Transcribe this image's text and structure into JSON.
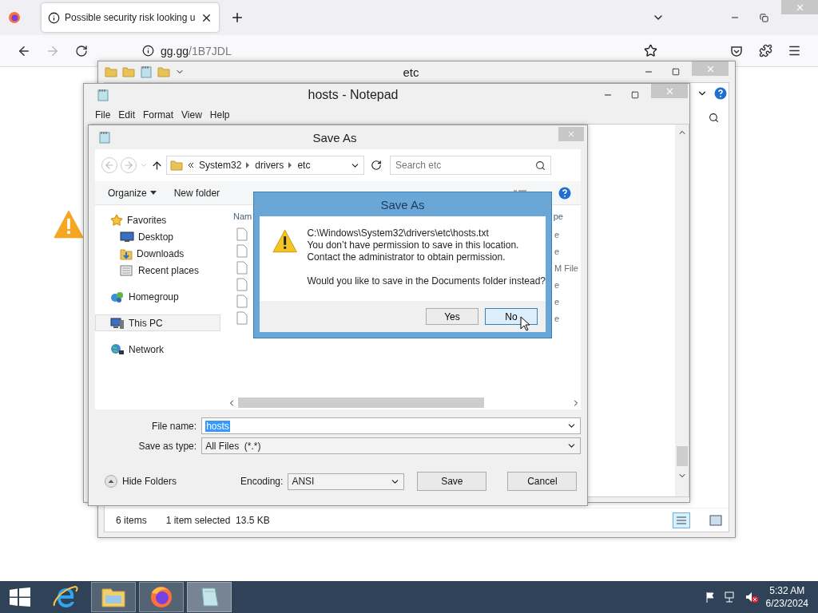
{
  "browser": {
    "tabs": [
      {
        "title": "Possible security risk looking u",
        "selected": true
      }
    ],
    "url": {
      "host": "gg.gg",
      "path": "/1B7JDL"
    }
  },
  "explorer": {
    "title": "etc",
    "status_items": "6 items",
    "status_selection": "1 item selected  13.5 KB"
  },
  "notepad": {
    "title": "hosts - Notepad",
    "menu": [
      "File",
      "Edit",
      "Format",
      "View",
      "Help"
    ]
  },
  "save_dialog": {
    "title": "Save As",
    "breadcrumb": [
      "System32",
      "drivers",
      "etc"
    ],
    "search": {
      "placeholder": "Search etc"
    },
    "toolbar": [
      "Organize",
      "New folder"
    ],
    "nav": [
      {
        "label": "Favorites",
        "kind": "star",
        "selected": false,
        "children": [
          {
            "label": "Desktop",
            "kind": "desktop",
            "selected": false
          },
          {
            "label": "Downloads",
            "kind": "downloads",
            "selected": false
          },
          {
            "label": "Recent places",
            "kind": "recent",
            "selected": false
          }
        ]
      },
      {
        "label": "Homegroup",
        "kind": "homegroup",
        "selected": false
      },
      {
        "label": "This PC",
        "kind": "pc",
        "selected": true
      },
      {
        "label": "Network",
        "kind": "network",
        "selected": false
      }
    ],
    "columns": [
      "Nam",
      "pe"
    ],
    "files": [
      {
        "type": "e"
      },
      {
        "type": "e"
      },
      {
        "type": "M File"
      },
      {
        "type": "e"
      },
      {
        "type": "e"
      },
      {
        "type": "e"
      }
    ],
    "file_name_label": "File name:",
    "file_name": {
      "value": "hosts",
      "highlighted": true
    },
    "save_type_label": "Save as type:",
    "save_type": "All Files  (*.*)",
    "hide_folders": "Hide Folders",
    "encoding_label": "Encoding:",
    "encoding": "ANSI",
    "buttons": [
      {
        "label": "Save"
      },
      {
        "label": "Cancel"
      }
    ]
  },
  "message_box": {
    "title": "Save As",
    "lines": [
      "C:\\Windows\\System32\\drivers\\etc\\hosts.txt",
      "You don’t have permission to save in this location.",
      "Contact the administrator to obtain permission."
    ],
    "question": "Would you like to save in the Documents folder instead?",
    "buttons": [
      {
        "label": "Yes",
        "focused": false
      },
      {
        "label": "No",
        "focused": true
      }
    ]
  },
  "taskbar": {
    "apps": [
      {
        "kind": "ie",
        "running": false,
        "selected": false
      },
      {
        "kind": "explorer",
        "running": true,
        "selected": false
      },
      {
        "kind": "firefox",
        "running": true,
        "selected": false
      },
      {
        "kind": "notepad",
        "running": true,
        "selected": true
      }
    ],
    "time": "5:32 AM",
    "date": "6/23/2024"
  }
}
